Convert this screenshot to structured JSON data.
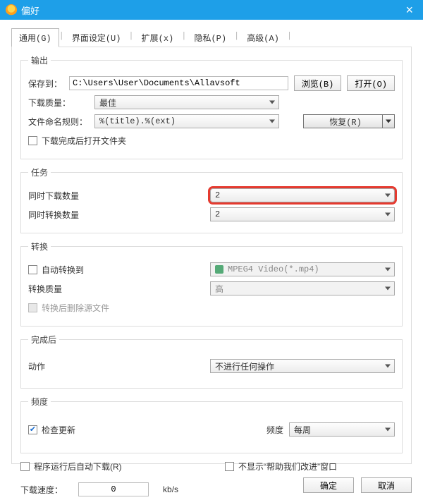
{
  "window": {
    "title": "偏好",
    "close": "×"
  },
  "tabs": [
    "通用(G)",
    "界面设定(U)",
    "扩展(x)",
    "隐私(P)",
    "高级(A)"
  ],
  "output": {
    "legend": "输出",
    "save_to_label": "保存到",
    "save_to_value": "C:\\Users\\User\\Documents\\Allavsoft",
    "browse": "浏览(B)",
    "open": "打开(O)",
    "quality_label": "下载质量",
    "quality_value": "最佳",
    "naming_label": "文件命名规则",
    "naming_value": "%(title).%(ext)",
    "restore": "恢复(R)",
    "open_folder_label": "下载完成后打开文件夹",
    "open_folder_checked": false
  },
  "tasks": {
    "legend": "任务",
    "dl_count_label": "同时下载数量",
    "dl_count_value": "2",
    "cv_count_label": "同时转换数量",
    "cv_count_value": "2"
  },
  "convert": {
    "legend": "转换",
    "auto_label": "自动转换到",
    "auto_checked": false,
    "format_value": "MPEG4 Video(*.mp4)",
    "quality_label": "转换质量",
    "quality_value": "高",
    "delete_src_label": "转换后删除源文件",
    "delete_src_checked": false
  },
  "after": {
    "legend": "完成后",
    "action_label": "动作",
    "action_value": "不进行任何操作"
  },
  "freq": {
    "legend": "频度",
    "check_update_label": "检查更新",
    "check_update_checked": true,
    "freq_label": "频度",
    "freq_value": "每周"
  },
  "misc": {
    "auto_dl_label": "程序运行后自动下载(R)",
    "auto_dl_checked": false,
    "hide_improve_label": "不显示“帮助我们改进”窗口",
    "hide_improve_checked": false,
    "speed_label": "下载速度",
    "speed_value": "0",
    "speed_unit": "kb/s"
  },
  "buttons": {
    "ok": "确定",
    "cancel": "取消"
  }
}
